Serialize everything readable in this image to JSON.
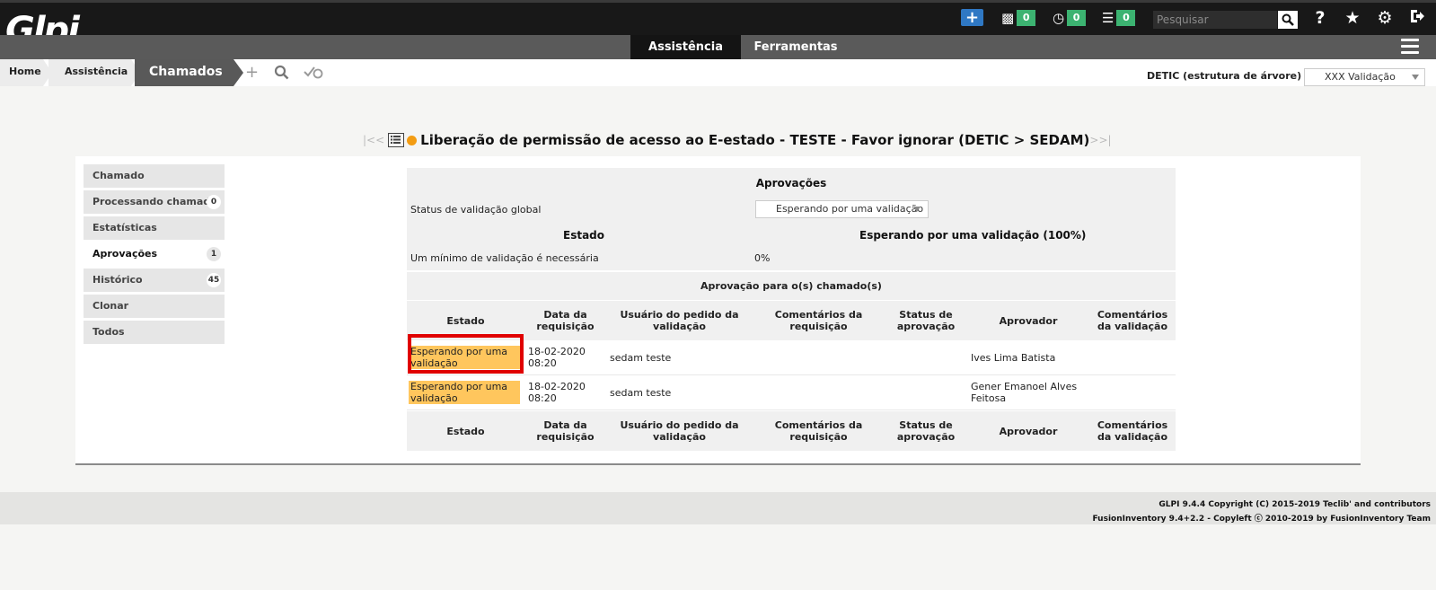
{
  "header": {
    "logo_text": "Glpi",
    "counters": [
      {
        "icon": "ticket-icon",
        "count": "0"
      },
      {
        "icon": "clock-icon",
        "count": "0"
      },
      {
        "icon": "tasklist-icon",
        "count": "0"
      }
    ],
    "search_placeholder": "Pesquisar",
    "menu_tabs": [
      "Assistência",
      "Ferramentas"
    ],
    "active_tab": "Assistência"
  },
  "breadcrumb": {
    "home": "Home",
    "assistencia": "Assistência",
    "current": "Chamados"
  },
  "entity": {
    "label": "DETIC (estrutura de árvore)",
    "selected": "XXX Validação"
  },
  "title": {
    "prev": "|<<",
    "next": ">>|",
    "text": "Liberação de permissão de acesso ao E-estado - TESTE - Favor ignorar (DETIC > SEDAM)",
    "status_color": "#f39c12"
  },
  "side_tabs": [
    {
      "label": "Chamado",
      "count": ""
    },
    {
      "label": "Processando chamado",
      "count": "0"
    },
    {
      "label": "Estatísticas",
      "count": ""
    },
    {
      "label": "Aprovações",
      "count": "1",
      "active": true
    },
    {
      "label": "Histórico",
      "count": "45"
    },
    {
      "label": "Clonar",
      "count": ""
    },
    {
      "label": "Todos",
      "count": ""
    }
  ],
  "approvals": {
    "heading": "Aprovações",
    "global_status_label": "Status de validação global",
    "global_status_value": "Esperando por uma validação",
    "state_heading": "Estado",
    "state_value_heading": "Esperando por uma validação (100%)",
    "min_label": "Um mínimo de validação é necessária",
    "min_value": "0%"
  },
  "validation_table": {
    "caption": "Aprovação para o(s) chamado(s)",
    "columns": [
      "Estado",
      "Data da requisição",
      "Usuário do pedido da validação",
      "Comentários da requisição",
      "Status de aprovação",
      "Aprovador",
      "Comentários da validação"
    ],
    "rows": [
      {
        "estado": "Esperando por uma validação",
        "data": "18-02-2020 08:20",
        "usuario": "sedam teste",
        "comentarios": "",
        "status": "",
        "aprovador": "Ives Lima Batista",
        "coment_val": ""
      },
      {
        "estado": "Esperando por uma validação",
        "data": "18-02-2020 08:20",
        "usuario": "sedam teste",
        "comentarios": "",
        "status": "",
        "aprovador": "Gener Emanoel Alves Feitosa",
        "coment_val": ""
      }
    ],
    "highlight_color": "#ffc65d"
  },
  "footer": {
    "line1": "GLPI 9.4.4 Copyright (C) 2015-2019 Teclib' and contributors",
    "line2": "FusionInventory 9.4+2.2 - Copyleft ⓒ 2010-2019 by FusionInventory Team"
  }
}
